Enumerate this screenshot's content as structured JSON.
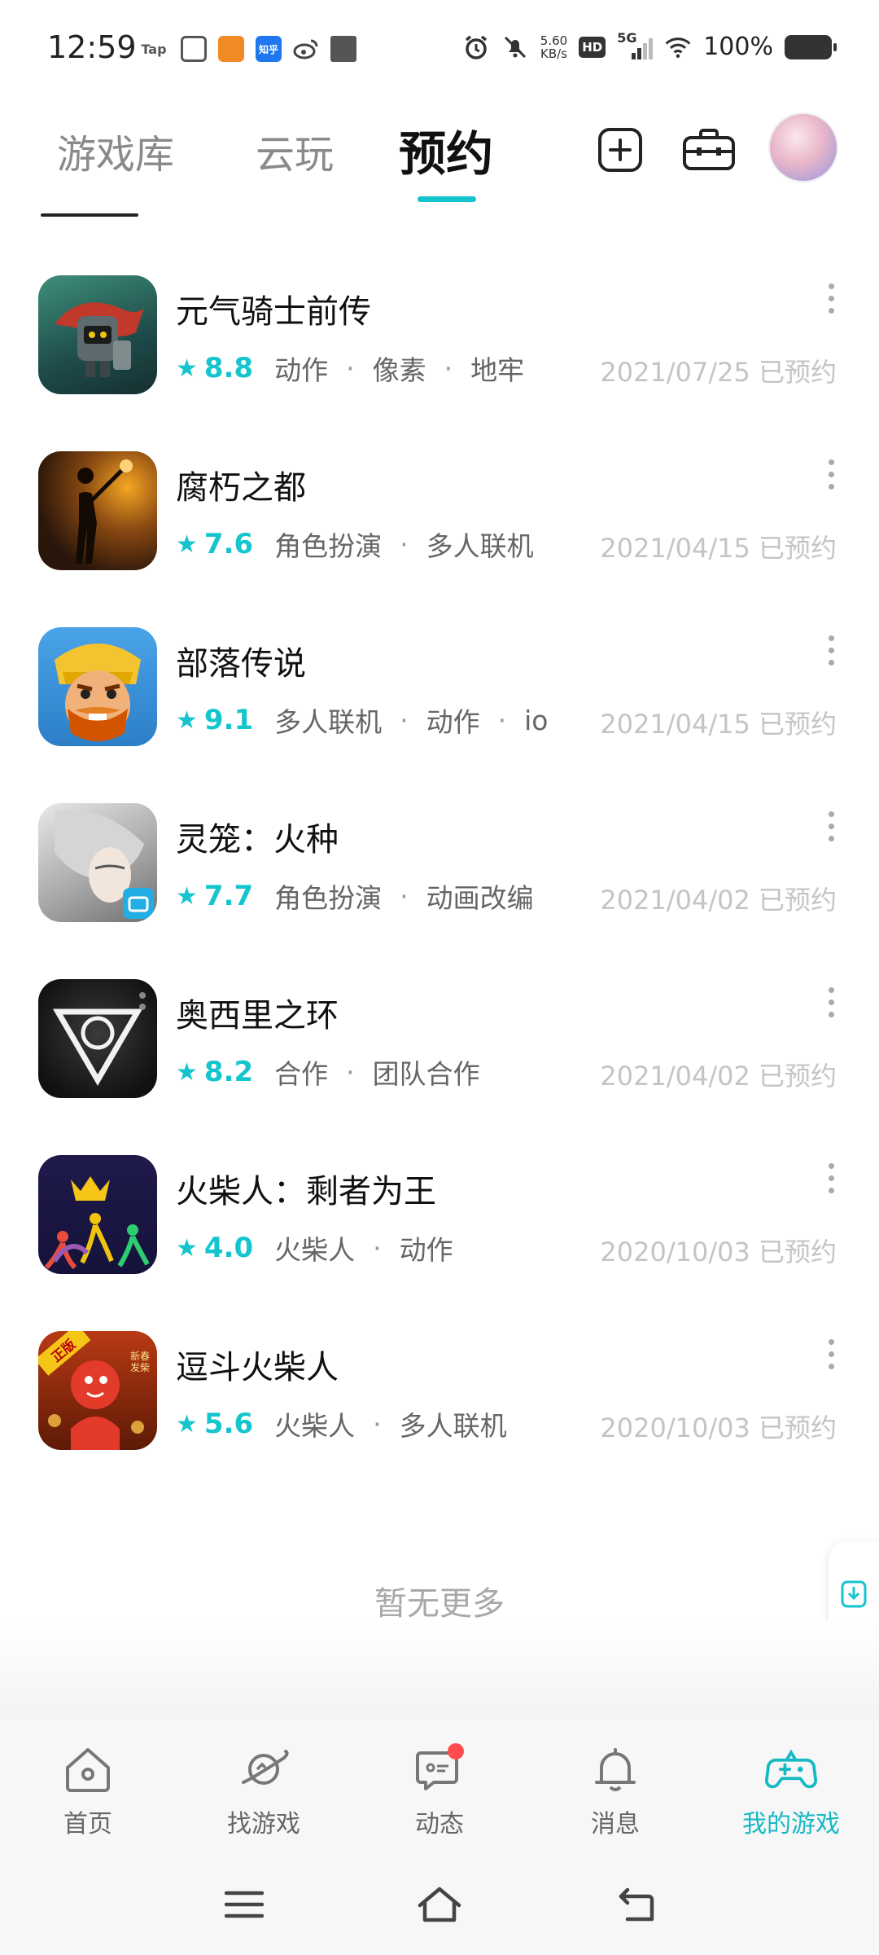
{
  "status_bar": {
    "time": "12:59",
    "apps": [
      {
        "name": "taptap-icon",
        "label": "Tap",
        "color": "#5c5c5c"
      },
      {
        "name": "app-icon-1",
        "label": "",
        "color": "#555555"
      },
      {
        "name": "app-icon-2",
        "label": "",
        "color": "#f08a24"
      },
      {
        "name": "zhihu-icon",
        "label": "知乎",
        "color": "#1f77f0"
      },
      {
        "name": "weibo-icon",
        "label": "",
        "color": "#444444"
      },
      {
        "name": "app-icon-3",
        "label": "",
        "color": "#555555"
      }
    ],
    "net_speed_value": "5.60",
    "net_speed_unit": "KB/s",
    "hd": "HD",
    "network": "5G",
    "battery": "100%"
  },
  "header": {
    "tabs": [
      {
        "label": "游戏库",
        "active": false
      },
      {
        "label": "云玩",
        "active": false
      },
      {
        "label": "预约",
        "active": true
      }
    ],
    "accent": "#15c5ce"
  },
  "games": [
    {
      "name": "元气骑士前传",
      "score": "8.8",
      "tags": [
        "动作",
        "像素",
        "地牢"
      ],
      "date": "2021/07/25 已预约"
    },
    {
      "name": "腐朽之都",
      "score": "7.6",
      "tags": [
        "角色扮演",
        "多人联机"
      ],
      "date": "2021/04/15 已预约"
    },
    {
      "name": "部落传说",
      "score": "9.1",
      "tags": [
        "多人联机",
        "动作",
        "io"
      ],
      "date": "2021/04/15 已预约"
    },
    {
      "name": "灵笼：火种",
      "score": "7.7",
      "tags": [
        "角色扮演",
        "动画改编"
      ],
      "date": "2021/04/02 已预约"
    },
    {
      "name": "奥西里之环",
      "score": "8.2",
      "tags": [
        "合作",
        "团队合作"
      ],
      "date": "2021/04/02 已预约"
    },
    {
      "name": "火柴人：剩者为王",
      "score": "4.0",
      "tags": [
        "火柴人",
        "动作"
      ],
      "date": "2020/10/03 已预约"
    },
    {
      "name": "逗斗火柴人",
      "score": "5.6",
      "tags": [
        "火柴人",
        "多人联机"
      ],
      "date": "2020/10/03 已预约"
    }
  ],
  "no_more": "暂无更多",
  "bottom_nav": [
    {
      "label": "首页",
      "icon": "home-icon",
      "active": false
    },
    {
      "label": "找游戏",
      "icon": "planet-icon",
      "active": false
    },
    {
      "label": "动态",
      "icon": "chat-icon",
      "active": false,
      "badge": true
    },
    {
      "label": "消息",
      "icon": "bell-icon",
      "active": false
    },
    {
      "label": "我的游戏",
      "icon": "gamepad-icon",
      "active": true
    }
  ],
  "icon_badge_text": {
    "game_7_banner": "正版",
    "game_7_side": "新春发柴"
  }
}
